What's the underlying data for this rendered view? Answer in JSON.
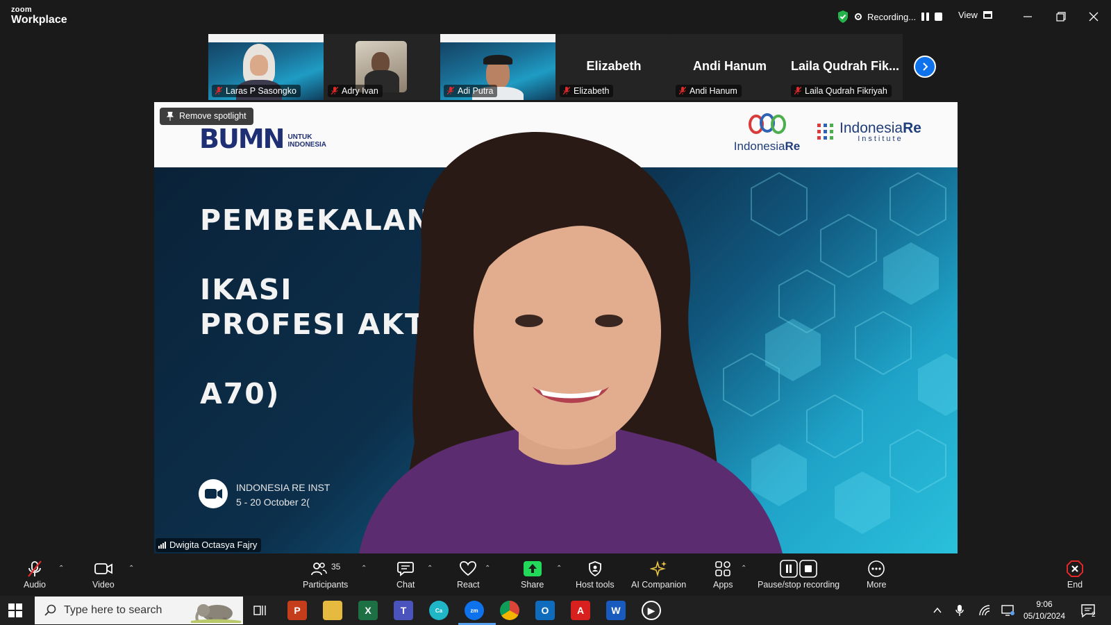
{
  "app": {
    "brand_top": "zoom",
    "brand_bottom": "Workplace"
  },
  "recording": {
    "label": "Recording..."
  },
  "view": {
    "label": "View"
  },
  "thumbnails": [
    {
      "name": "Laras P Sasongko"
    },
    {
      "name": "Adry Ivan"
    },
    {
      "name": "Adi Putra"
    },
    {
      "name": "Elizabeth",
      "big": "Elizabeth"
    },
    {
      "name": "Andi Hanum",
      "big": "Andi Hanum"
    },
    {
      "name": "Laila Qudrah Fikriyah",
      "big": "Laila Qudrah Fik..."
    }
  ],
  "spotlight": {
    "remove_label": "Remove spotlight",
    "speaker_name": "Dwigita Octasya Fajry"
  },
  "slide": {
    "bumn_big": "BUMN",
    "bumn_small_1": "UNTUK",
    "bumn_small_2": "INDONESIA",
    "ire_name_1": "Indonesia",
    "ire_name_2": "Re",
    "iri_name_1": "Indonesia",
    "iri_name_2": "Re",
    "iri_sub": "Institute",
    "title_line_1": "PEMBEKALAN U",
    "title_line_1b": "IKASI",
    "title_line_2": "PROFESI AKTU",
    "title_line_2b": "A70)",
    "event_line_1": "INDONESIA RE INST",
    "event_line_2": "5 - 20 October 2("
  },
  "toolbar": {
    "audio": "Audio",
    "video": "Video",
    "participants": "Participants",
    "participants_count": "35",
    "chat": "Chat",
    "react": "React",
    "share": "Share",
    "host_tools": "Host tools",
    "ai_companion": "AI Companion",
    "apps": "Apps",
    "pause_stop": "Pause/stop recording",
    "more": "More",
    "end": "End"
  },
  "taskbar": {
    "search_placeholder": "Type here to search",
    "time": "9:06",
    "date": "05/10/2024",
    "notif_count": "2"
  },
  "colors": {
    "zoom_blue": "#0e72ed",
    "share_green": "#23d959",
    "end_red": "#e02828",
    "bumn_navy": "#1e2f73"
  }
}
